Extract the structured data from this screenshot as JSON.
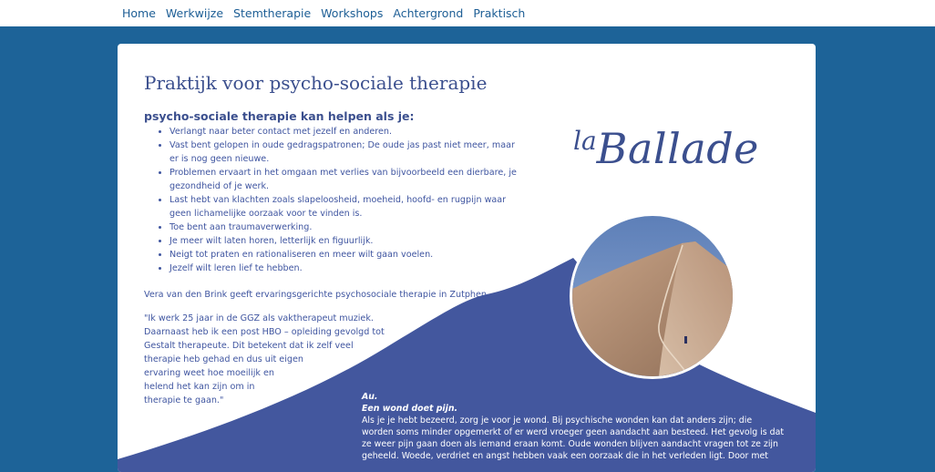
{
  "nav": {
    "items": [
      {
        "label": "Home"
      },
      {
        "label": "Werkwijze"
      },
      {
        "label": "Stemtherapie"
      },
      {
        "label": "Workshops"
      },
      {
        "label": "Achtergrond"
      },
      {
        "label": "Praktisch"
      }
    ]
  },
  "main": {
    "title": "Praktijk voor psycho-sociale therapie",
    "subheading": "psycho-sociale therapie kan helpen als je:",
    "bullets": [
      [
        "Verlangt naar beter contact met jezelf en anderen."
      ],
      [
        "Vast bent gelopen in oude gedragspatronen; De oude jas past niet meer, maar",
        "er is nog geen nieuwe."
      ],
      [
        "Problemen ervaart in het omgaan met verlies van bijvoorbeeld een dierbare, je",
        "gezondheid of je werk."
      ],
      [
        "Last hebt van klachten zoals slapeloosheid, moeheid,  hoofd- en rugpijn waar",
        "geen lichamelijke oorzaak voor te vinden is."
      ],
      [
        "Toe bent aan traumaverwerking."
      ],
      [
        "Je meer wilt laten horen, letterlijk en figuurlijk."
      ],
      [
        "Neigt tot praten en rationaliseren en meer wilt gaan voelen."
      ],
      [
        "Jezelf wilt leren lief te hebben."
      ]
    ],
    "intro": "Vera van den Brink geeft ervaringsgerichte psychosociale therapie in Zutphen.",
    "quote_lines": [
      "\"Ik werk 25 jaar in de GGZ als vaktherapeut muziek.",
      "Daarnaast heb ik een post HBO – opleiding gevolgd tot",
      "Gestalt therapeute. Dit betekent dat ik zelf veel",
      "therapie heb gehad en dus uit eigen",
      "ervaring weet hoe moeilijk en",
      "helend het kan zijn om in",
      "therapie te gaan.\""
    ]
  },
  "logo": {
    "small": "la",
    "large": "Ballade",
    "color": "#3b4f8e"
  },
  "bottom": {
    "heading1": "Au.",
    "heading2": "Een wond doet pijn.",
    "lines": [
      "Als je je hebt bezeerd, zorg je voor je wond. Bij psychische wonden kan dat anders zijn; die",
      "worden soms minder opgemerkt of er werd vroeger geen aandacht aan besteed. Het gevolg is dat",
      "ze weer pijn gaan doen als iemand eraan komt. Oude wonden blijven aandacht vragen tot ze zijn",
      "geheeld. Woede, verdriet en angst hebben vaak een oorzaak die in het verleden ligt. Door met"
    ]
  },
  "colors": {
    "page_bg": "#1d6398",
    "nav_text": "#1d5e95",
    "accent": "#3b4f8e",
    "mountain": "#43579e"
  }
}
